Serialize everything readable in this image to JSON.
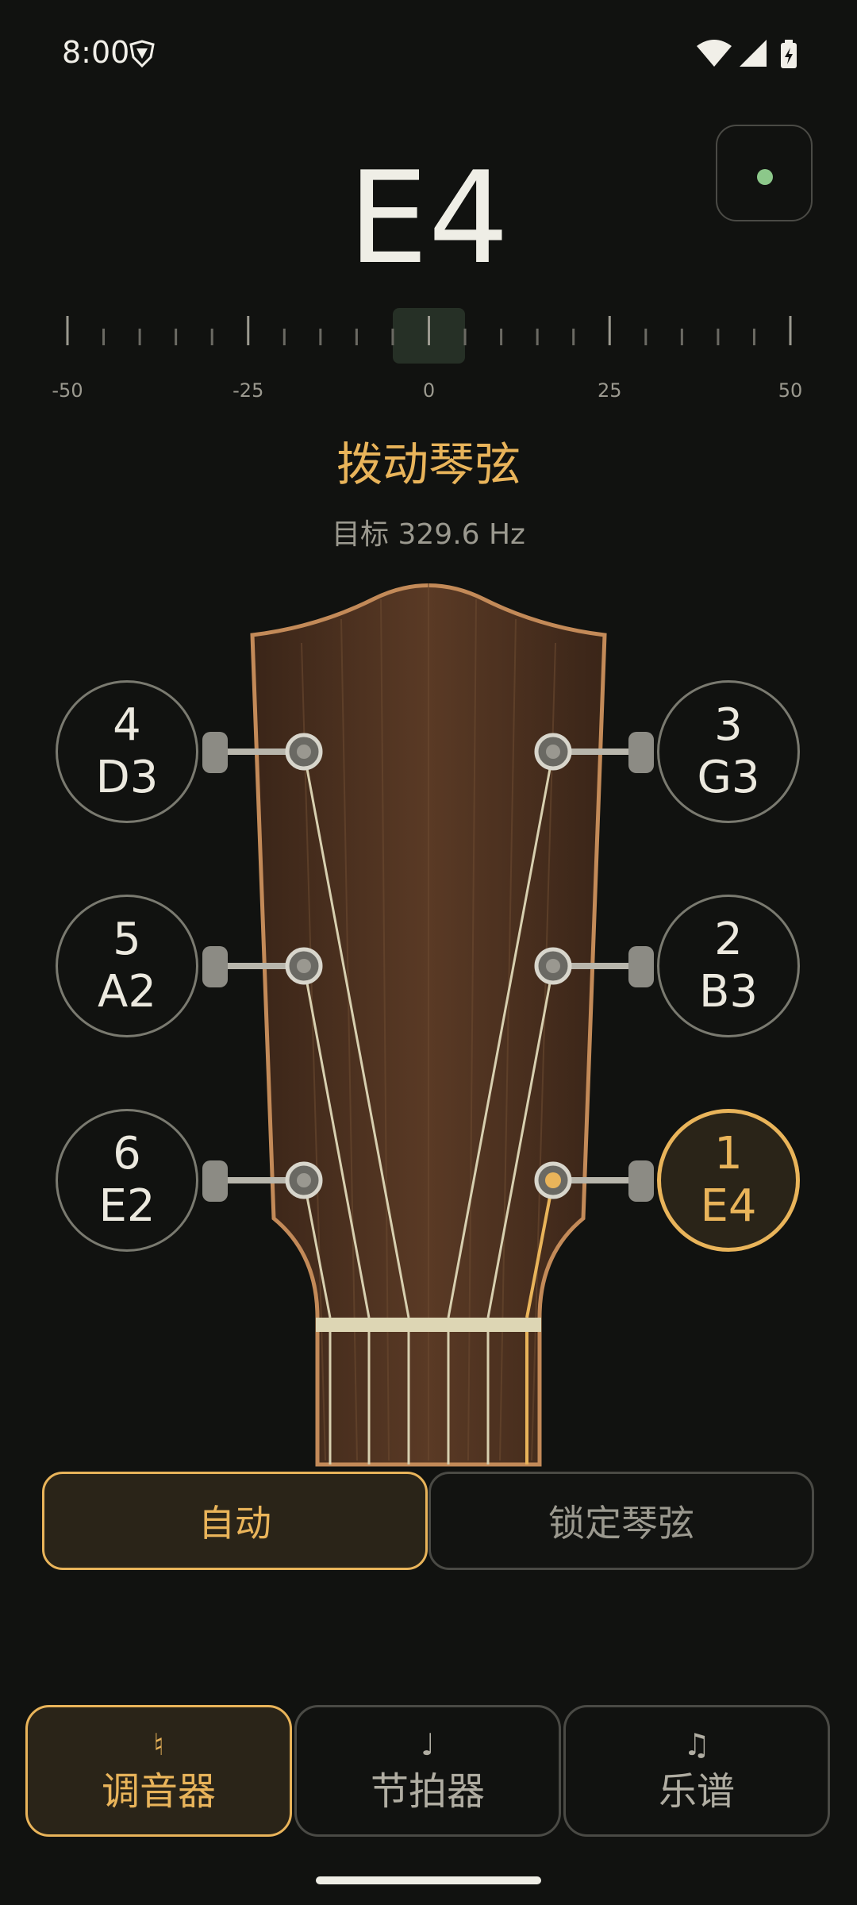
{
  "status_bar": {
    "time": "8:00"
  },
  "tuner": {
    "note": "E4",
    "scale_labels": [
      "-50",
      "-25",
      "0",
      "25",
      "50"
    ],
    "instruction": "拨动琴弦",
    "target": "目标 329.6 Hz"
  },
  "strings": [
    {
      "number": "4",
      "note": "D3",
      "active": false
    },
    {
      "number": "3",
      "note": "G3",
      "active": false
    },
    {
      "number": "5",
      "note": "A2",
      "active": false
    },
    {
      "number": "2",
      "note": "B3",
      "active": false
    },
    {
      "number": "6",
      "note": "E2",
      "active": false
    },
    {
      "number": "1",
      "note": "E4",
      "active": true
    }
  ],
  "modes": {
    "auto": "自动",
    "lock": "锁定琴弦",
    "selected": "自动"
  },
  "nav": {
    "items": [
      {
        "icon": "♮",
        "label": "调音器",
        "active": true
      },
      {
        "icon": "♩",
        "label": "节拍器",
        "active": false
      },
      {
        "icon": "♫",
        "label": "乐谱",
        "active": false
      }
    ]
  },
  "colors": {
    "accent": "#e9b45a",
    "background": "#111210",
    "indicator": "#8cc88a",
    "wood": "#4a3021"
  }
}
